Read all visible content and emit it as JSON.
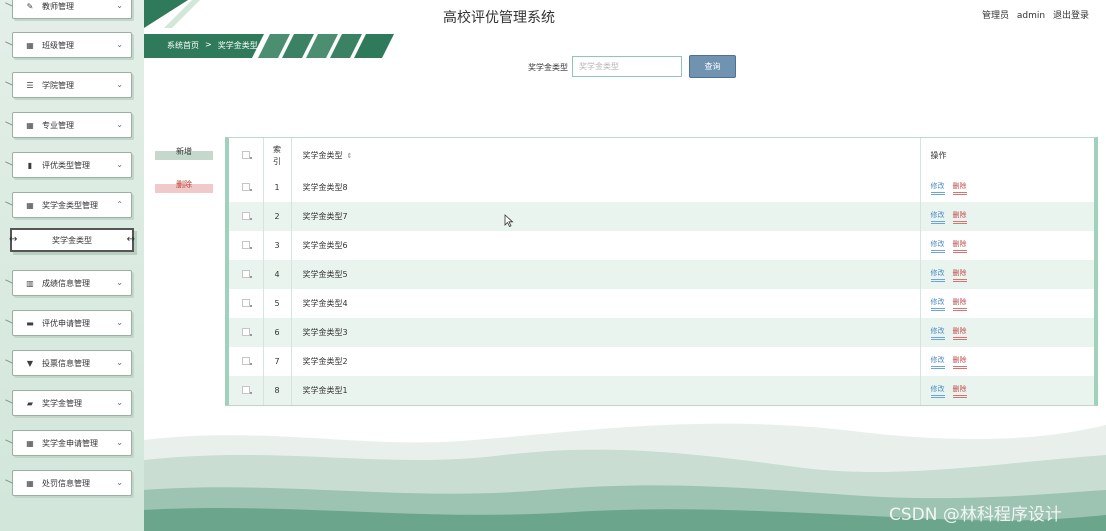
{
  "header": {
    "title": "高校评优管理系统",
    "user_role": "管理员",
    "user_name": "admin",
    "logout": "退出登录"
  },
  "breadcrumb": {
    "home": "系统首页",
    "separator": ">",
    "current": "奖学金类型"
  },
  "sidebar": {
    "items": [
      {
        "label": "教师管理",
        "icon": "edit-icon"
      },
      {
        "label": "班级管理",
        "icon": "grid-icon"
      },
      {
        "label": "学院管理",
        "icon": "list-icon"
      },
      {
        "label": "专业管理",
        "icon": "grid-icon"
      },
      {
        "label": "评优类型管理",
        "icon": "bar-chart-icon"
      },
      {
        "label": "奖学金类型管理",
        "icon": "grid-icon",
        "expanded": true
      },
      {
        "label": "成绩信息管理",
        "icon": "chart-icon"
      },
      {
        "label": "评优申请管理",
        "icon": "message-icon"
      },
      {
        "label": "投票信息管理",
        "icon": "vote-icon"
      },
      {
        "label": "奖学金管理",
        "icon": "briefcase-icon"
      },
      {
        "label": "奖学金申请管理",
        "icon": "grid-icon"
      },
      {
        "label": "处罚信息管理",
        "icon": "grid-icon"
      }
    ],
    "sub_item": "奖学金类型"
  },
  "search": {
    "label": "奖学金类型",
    "placeholder": "奖学金类型",
    "button": "查询"
  },
  "actions": {
    "add": "新增",
    "delete": "删除"
  },
  "table": {
    "headers": {
      "index": "索引",
      "name": "奖学金类型",
      "operation": "操作"
    },
    "edit_label": "修改",
    "delete_label": "删除",
    "rows": [
      {
        "index": "1",
        "name": "奖学金类型8"
      },
      {
        "index": "2",
        "name": "奖学金类型7"
      },
      {
        "index": "3",
        "name": "奖学金类型6"
      },
      {
        "index": "4",
        "name": "奖学金类型5"
      },
      {
        "index": "5",
        "name": "奖学金类型4"
      },
      {
        "index": "6",
        "name": "奖学金类型3"
      },
      {
        "index": "7",
        "name": "奖学金类型2"
      },
      {
        "index": "8",
        "name": "奖学金类型1"
      }
    ]
  },
  "watermark": "CSDN @林科程序设计",
  "colors": {
    "accent_green": "#2f7a5a",
    "search_button": "#6f93b0",
    "edit_link": "#4a8ac4",
    "delete_link": "#c44b4b",
    "row_alt": "#eaf4ef"
  }
}
